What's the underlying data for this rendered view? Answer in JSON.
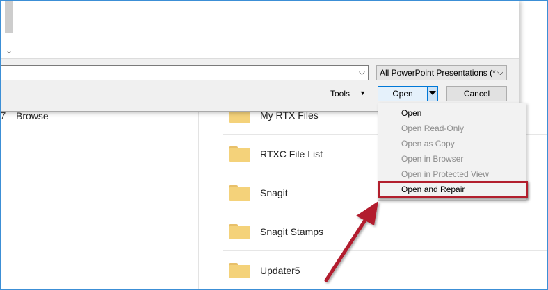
{
  "background": {
    "left_nav": {
      "browse_label": "Browse",
      "browse_icon": "folder-browse-icon"
    },
    "folders": [
      {
        "name": "My RTX Files",
        "icon": "folder-icon"
      },
      {
        "name": "RTXC File List",
        "icon": "folder-icon"
      },
      {
        "name": "Snagit",
        "icon": "folder-icon"
      },
      {
        "name": "Snagit Stamps",
        "icon": "folder-icon"
      },
      {
        "name": "Updater5",
        "icon": "folder-icon"
      }
    ]
  },
  "dialog": {
    "filename_value": "",
    "filter_selected": "All PowerPoint Presentations (*",
    "tools_label": "Tools",
    "open_label": "Open",
    "cancel_label": "Cancel"
  },
  "open_menu": {
    "items": [
      {
        "label": "Open",
        "enabled": true
      },
      {
        "label": "Open Read-Only",
        "enabled": false
      },
      {
        "label": "Open as Copy",
        "enabled": false
      },
      {
        "label": "Open in Browser",
        "enabled": false
      },
      {
        "label": "Open in Protected View",
        "enabled": false
      },
      {
        "label": "Open and Repair",
        "enabled": true,
        "highlighted": true
      }
    ]
  },
  "colors": {
    "highlight_box": "#b21f2d",
    "arrow": "#b21f2d",
    "accent": "#0078d7",
    "folder": "#f4d27a"
  }
}
